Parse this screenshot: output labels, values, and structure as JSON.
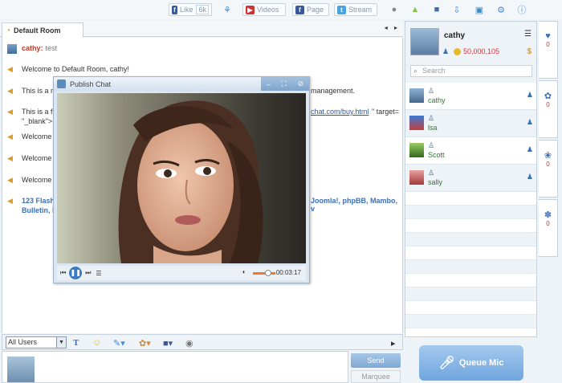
{
  "toolbar": {
    "like_label": "Like",
    "like_count": "6k",
    "videos_label": "Videos",
    "page_label": "Page",
    "stream_label": "Stream",
    "icons": [
      "butterfly-icon",
      "apple-icon",
      "android-icon",
      "app-icon",
      "download-icon",
      "gift-icon",
      "gear-icon",
      "info-icon"
    ]
  },
  "room": {
    "tab_label": "Default Room",
    "nav": "◂ ▸"
  },
  "messages": [
    {
      "user": "cathy:",
      "text": "test"
    },
    {
      "text": "Welcome to Default Room, cathy!"
    },
    {
      "text_prefix": "This is a m",
      "text_suffix": "management."
    },
    {
      "text_prefix": "This is a fr",
      "link": "chat.com/buy.html",
      "text_suffix": "\" target=",
      "line2": "\"_blank\">..."
    },
    {
      "text": "Welcome t"
    },
    {
      "text": "Welcome t"
    },
    {
      "text": "Welcome t"
    },
    {
      "text_prefix": "123 Flash",
      "text_suffix": "Joomla!, phpBB, Mambo, v",
      "line2": "Bulletin, I"
    }
  ],
  "input": {
    "audience": "All Users",
    "send_label": "Send",
    "marquee_label": "Marquee"
  },
  "me": {
    "name": "cathy",
    "coins": "50,000,105"
  },
  "search": {
    "placeholder": "Search"
  },
  "users": [
    {
      "name": "cathy",
      "color": "#2a7a2a"
    },
    {
      "name": "lsa",
      "color": "#2a7a2a"
    },
    {
      "name": "Scott",
      "color": "#2a7a2a"
    },
    {
      "name": "sally",
      "color": "#2a7a2a"
    }
  ],
  "gift_tabs": [
    "0",
    "0",
    "0",
    "0"
  ],
  "queue_mic_label": "Queue Mic",
  "video": {
    "title": "Publish Chat",
    "time": "00:03:17",
    "volume": 0.6
  }
}
